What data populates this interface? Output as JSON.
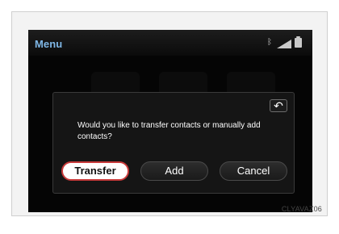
{
  "header": {
    "title": "Menu",
    "status_icons": [
      "bluetooth-icon",
      "signal-icon",
      "battery-icon"
    ]
  },
  "dialog": {
    "message": "Would you like to transfer contacts or manually add contacts?",
    "back_icon": "back-icon",
    "buttons": {
      "transfer": "Transfer",
      "add": "Add",
      "cancel": "Cancel"
    }
  },
  "footer": {
    "caption": "CLYAVAZ06"
  },
  "colors": {
    "title": "#7fb7e6",
    "highlight_border": "#c83a3a"
  }
}
